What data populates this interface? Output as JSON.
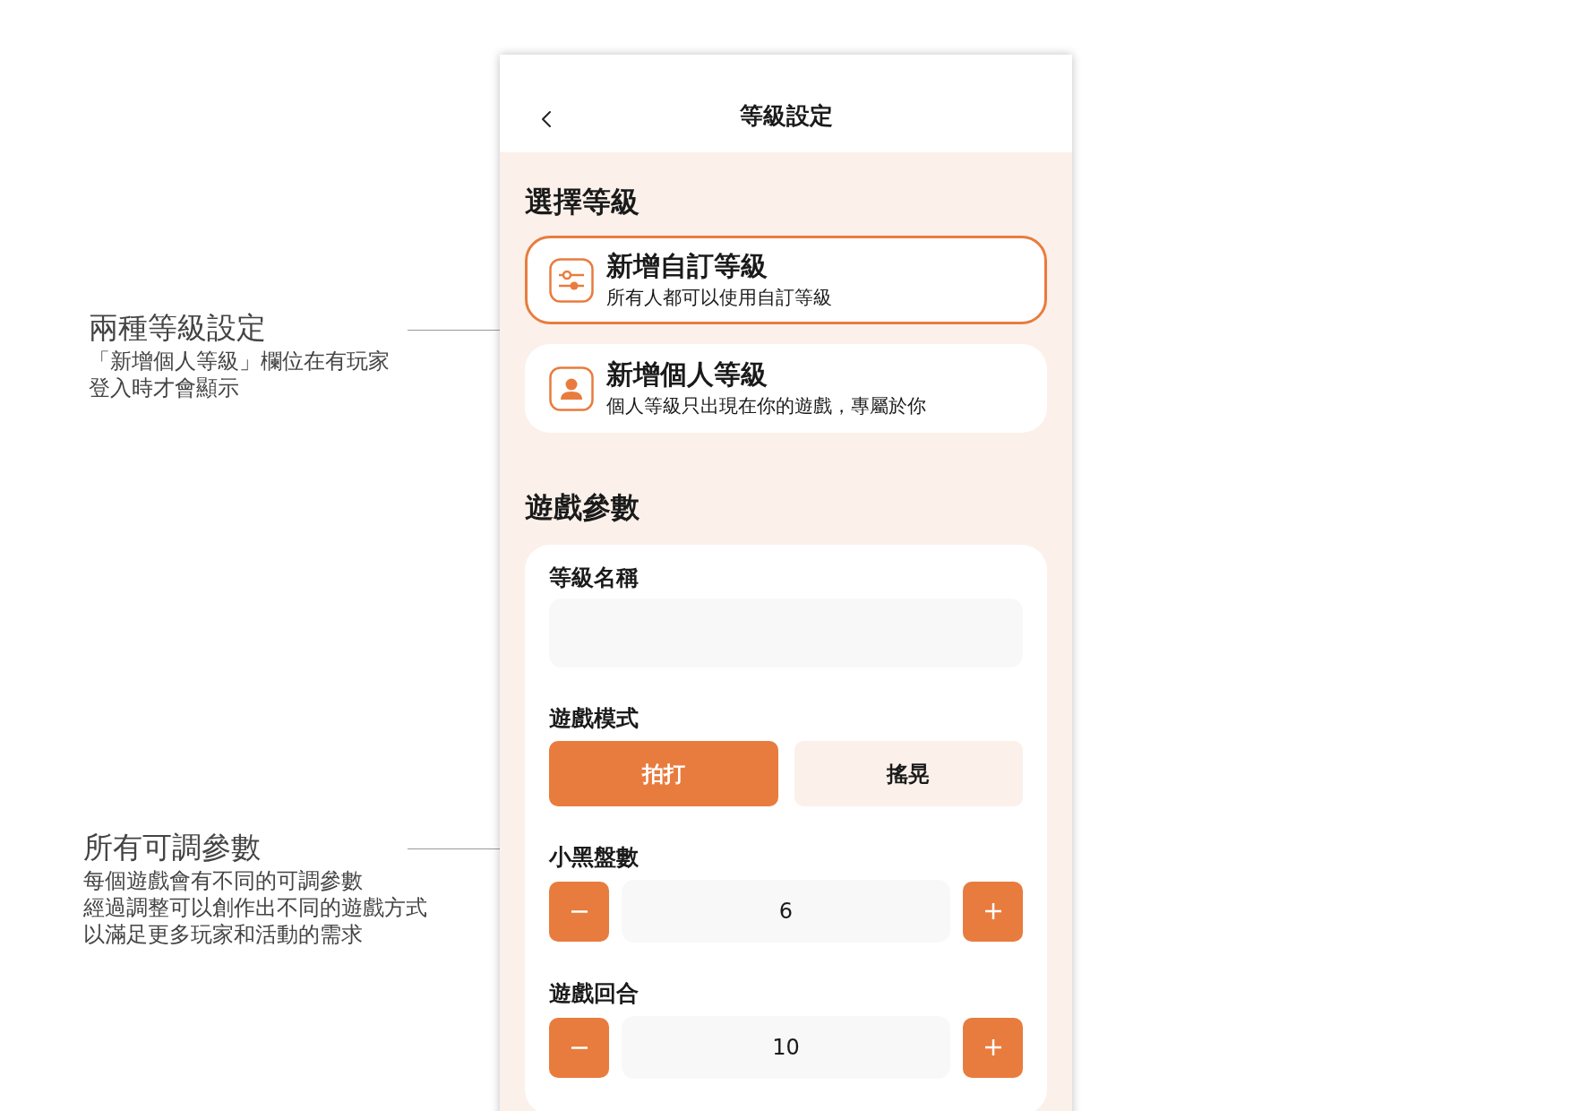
{
  "annotations": [
    {
      "title": "兩種等級設定",
      "lines": [
        "「新增個人等級」欄位在有玩家",
        "登入時才會顯示"
      ]
    },
    {
      "title": "所有可調參數",
      "lines": [
        "每個遊戲會有不同的可調參數",
        "經過調整可以創作出不同的遊戲方式",
        "以滿足更多玩家和活動的需求"
      ]
    }
  ],
  "header": {
    "title": "等級設定"
  },
  "level_section": {
    "title": "選擇等級",
    "options": [
      {
        "kind": "custom",
        "title": "新增自訂等級",
        "subtitle": "所有人都可以使用自訂等級",
        "selected": true
      },
      {
        "kind": "personal",
        "title": "新增個人等級",
        "subtitle": "個人等級只出現在你的遊戲，專屬於你",
        "selected": false
      }
    ]
  },
  "params_section": {
    "title": "遊戲參數",
    "name_field": {
      "label": "等級名稱"
    },
    "mode": {
      "label": "遊戲模式",
      "options": [
        {
          "label": "拍打",
          "selected": true
        },
        {
          "label": "搖晃",
          "selected": false
        }
      ]
    },
    "steppers": [
      {
        "label": "小黑盤數",
        "value": "6"
      },
      {
        "label": "遊戲回合",
        "value": "10"
      }
    ]
  }
}
